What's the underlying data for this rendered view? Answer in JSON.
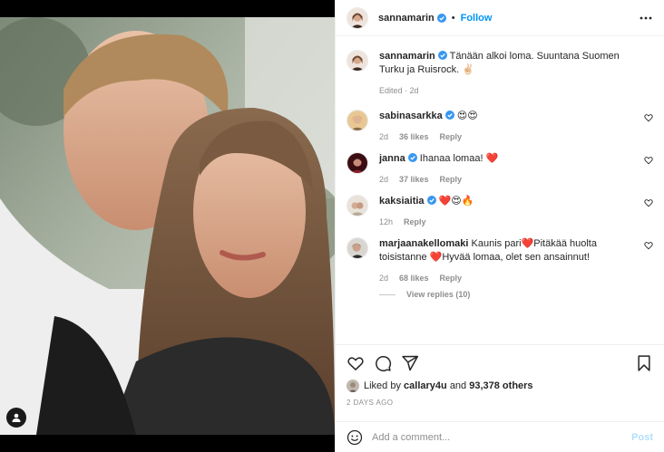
{
  "post": {
    "author": "sannamarin",
    "follow_label": "Follow",
    "caption": "Tänään alkoi loma. Suuntana Suomen Turku ja Ruisrock.",
    "caption_emoji": "✌🏻",
    "caption_meta": "Edited · 2d"
  },
  "comments": [
    {
      "user": "sabinasarkka",
      "text": "😍😍",
      "time": "2d",
      "likes": "36 likes",
      "reply": "Reply",
      "verified": true
    },
    {
      "user": "janna",
      "text": "Ihanaa lomaa! ❤️",
      "time": "2d",
      "likes": "37 likes",
      "reply": "Reply",
      "verified": true
    },
    {
      "user": "kaksiaitia",
      "text": "❤️😍🔥",
      "time": "12h",
      "likes": "",
      "reply": "Reply",
      "verified": true
    },
    {
      "user": "marjaanakellomaki",
      "text": "Kaunis pari❤️Pitäkää huolta toisistanne ❤️Hyvää lomaa, olet sen ansainnut!",
      "time": "2d",
      "likes": "68 likes",
      "reply": "Reply",
      "verified": false
    }
  ],
  "view_replies": "View replies (10)",
  "likes": {
    "prefix": "Liked by",
    "user": "callary4u",
    "joiner": "and",
    "others": "93,378 others"
  },
  "date": "2 DAYS AGO",
  "add_comment": {
    "placeholder": "Add a comment...",
    "post_label": "Post"
  },
  "icons": [
    "heart-icon",
    "comment-icon",
    "share-icon",
    "bookmark-icon",
    "more-icon",
    "verified-icon",
    "emoji-icon",
    "user-tag-icon"
  ],
  "colors": {
    "link": "#0095f6",
    "verified": "#3897f0",
    "muted": "#8e8e8e",
    "post_disabled": "#b2dffc"
  }
}
